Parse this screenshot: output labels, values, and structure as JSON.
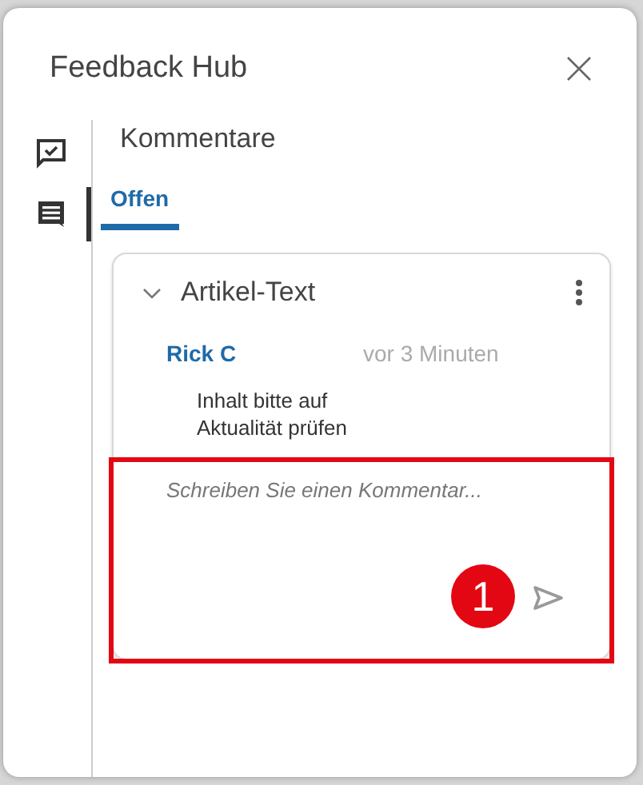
{
  "window": {
    "title": "Feedback Hub"
  },
  "rail": [
    {
      "kind": "review",
      "selected": false
    },
    {
      "kind": "comments",
      "selected": true
    }
  ],
  "section_title": "Kommentare",
  "tabs": [
    {
      "label": "Offen",
      "selected": true
    }
  ],
  "thread": {
    "title": "Artikel-Text",
    "expanded": true,
    "comments": [
      {
        "author": "Rick C",
        "time": "vor 3 Minuten",
        "text": "Inhalt bitte auf Aktualität prüfen"
      }
    ],
    "reply": {
      "placeholder": "Schreiben Sie einen Kommentar..."
    }
  },
  "annotation": {
    "number": "1"
  }
}
